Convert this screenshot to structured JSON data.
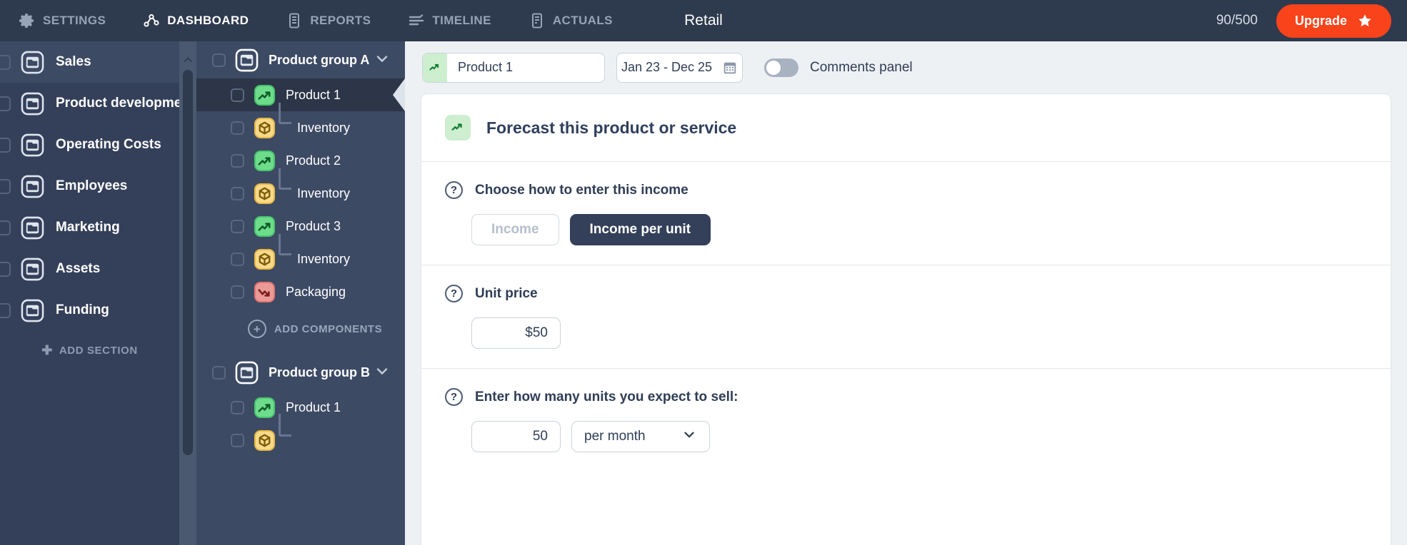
{
  "topbar": {
    "nav": [
      {
        "label": "SETTINGS",
        "icon": "gear-icon",
        "active": false
      },
      {
        "label": "DASHBOARD",
        "icon": "dashboard-nodes-icon",
        "active": true
      },
      {
        "label": "REPORTS",
        "icon": "reports-document-icon",
        "active": false
      },
      {
        "label": "TIMELINE",
        "icon": "timeline-sliders-icon",
        "active": false
      },
      {
        "label": "ACTUALS",
        "icon": "actuals-document-icon",
        "active": false
      }
    ],
    "title": "Retail",
    "quota": "90/500",
    "upgrade_label": "Upgrade",
    "upgrade_icon": "star-icon",
    "brand_accent": "#f9431b",
    "bar_color": "#2e3a4d"
  },
  "sidebar": {
    "items": [
      {
        "label": "Sales",
        "icon": "folder-icon",
        "highlighted": true
      },
      {
        "label": "Product development",
        "icon": "folder-icon",
        "highlighted": false
      },
      {
        "label": "Operating Costs",
        "icon": "folder-icon",
        "highlighted": false
      },
      {
        "label": "Employees",
        "icon": "folder-icon",
        "highlighted": false
      },
      {
        "label": "Marketing",
        "icon": "folder-icon",
        "highlighted": false
      },
      {
        "label": "Assets",
        "icon": "folder-icon",
        "highlighted": false
      },
      {
        "label": "Funding",
        "icon": "folder-icon",
        "highlighted": false
      }
    ],
    "add_section_label": "ADD SECTION",
    "add_section_icon": "plus-icon"
  },
  "tree": {
    "groups": [
      {
        "label": "Product group A",
        "icon": "folder-icon",
        "chevron": "chevron-down-icon",
        "rows": [
          {
            "label": "Product 1",
            "icon": "income-trend-icon",
            "color": "green",
            "indent": false,
            "selected": true
          },
          {
            "label": "Inventory",
            "icon": "inventory-cube-icon",
            "color": "yellow",
            "indent": true,
            "selected": false
          },
          {
            "label": "Product 2",
            "icon": "income-trend-icon",
            "color": "green",
            "indent": false,
            "selected": false
          },
          {
            "label": "Inventory",
            "icon": "inventory-cube-icon",
            "color": "yellow",
            "indent": true,
            "selected": false
          },
          {
            "label": "Product 3",
            "icon": "income-trend-icon",
            "color": "green",
            "indent": false,
            "selected": false
          },
          {
            "label": "Inventory",
            "icon": "inventory-cube-icon",
            "color": "yellow",
            "indent": true,
            "selected": false
          },
          {
            "label": "Packaging",
            "icon": "cost-trend-icon",
            "color": "red",
            "indent": false,
            "selected": false
          }
        ],
        "add_components_label": "ADD COMPONENTS",
        "add_components_icon": "circle-plus-icon"
      },
      {
        "label": "Product group B",
        "icon": "folder-icon",
        "chevron": "chevron-down-icon",
        "rows": [
          {
            "label": "Product 1",
            "icon": "income-trend-icon",
            "color": "green",
            "indent": false,
            "selected": false
          },
          {
            "label": "",
            "icon": "inventory-cube-icon",
            "color": "yellow",
            "indent": true,
            "selected": false
          }
        ]
      }
    ]
  },
  "main": {
    "toolbar": {
      "product_name": "Product 1",
      "product_icon": "income-trend-icon",
      "date_range": "Jan 23 - Dec 25",
      "calendar_icon": "calendar-icon",
      "comments_label": "Comments panel",
      "comments_on": false
    },
    "card": {
      "title": "Forecast this product or service",
      "title_icon": "income-trend-icon",
      "sections": [
        {
          "help_icon": "help-icon",
          "label": "Choose how to enter this income",
          "options": [
            {
              "label": "Income",
              "selected": false
            },
            {
              "label": "Income per unit",
              "selected": true
            }
          ]
        },
        {
          "help_icon": "help-icon",
          "label": "Unit price",
          "value": "$50"
        },
        {
          "help_icon": "help-icon",
          "label": "Enter how many units you expect to sell:",
          "value": "50",
          "frequency": "per month",
          "frequency_chevron": "chevron-down-icon"
        }
      ]
    }
  }
}
